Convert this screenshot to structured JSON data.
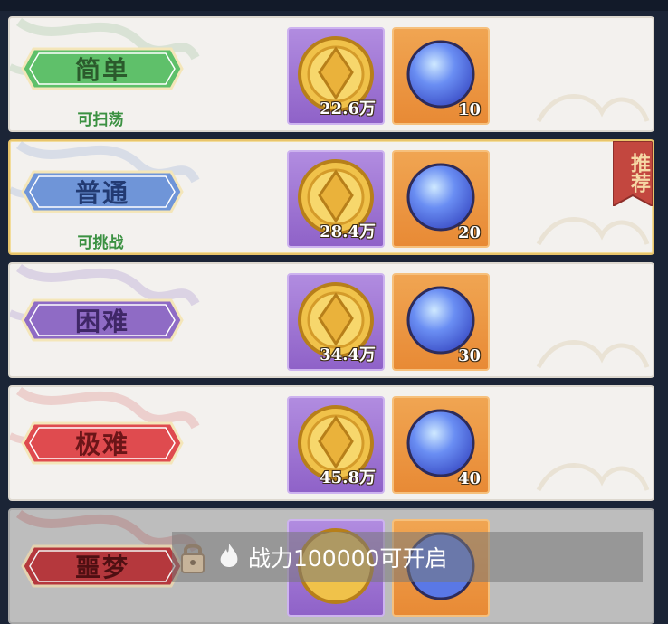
{
  "difficulties": [
    {
      "label": "简单",
      "status": "可扫荡",
      "coin_qty": "22.6万",
      "orb_qty": "10",
      "color": "#5fc06a"
    },
    {
      "label": "普通",
      "status": "可挑战",
      "coin_qty": "28.4万",
      "orb_qty": "20",
      "color": "#6f95d8"
    },
    {
      "label": "困难",
      "status": "",
      "coin_qty": "34.4万",
      "orb_qty": "30",
      "color": "#8f6bc5"
    },
    {
      "label": "极难",
      "status": "",
      "coin_qty": "45.8万",
      "orb_qty": "40",
      "color": "#df4b4f"
    },
    {
      "label": "噩梦",
      "status": "",
      "coin_qty": "",
      "orb_qty": "",
      "color": "#b5383d"
    }
  ],
  "recommend_tag": "推荐",
  "lock": {
    "text": "战力100000可开启"
  },
  "icons": {
    "coin": "gold-coin-icon",
    "orb": "blue-orb-icon",
    "lock": "padlock-icon",
    "flame": "flame-icon"
  }
}
